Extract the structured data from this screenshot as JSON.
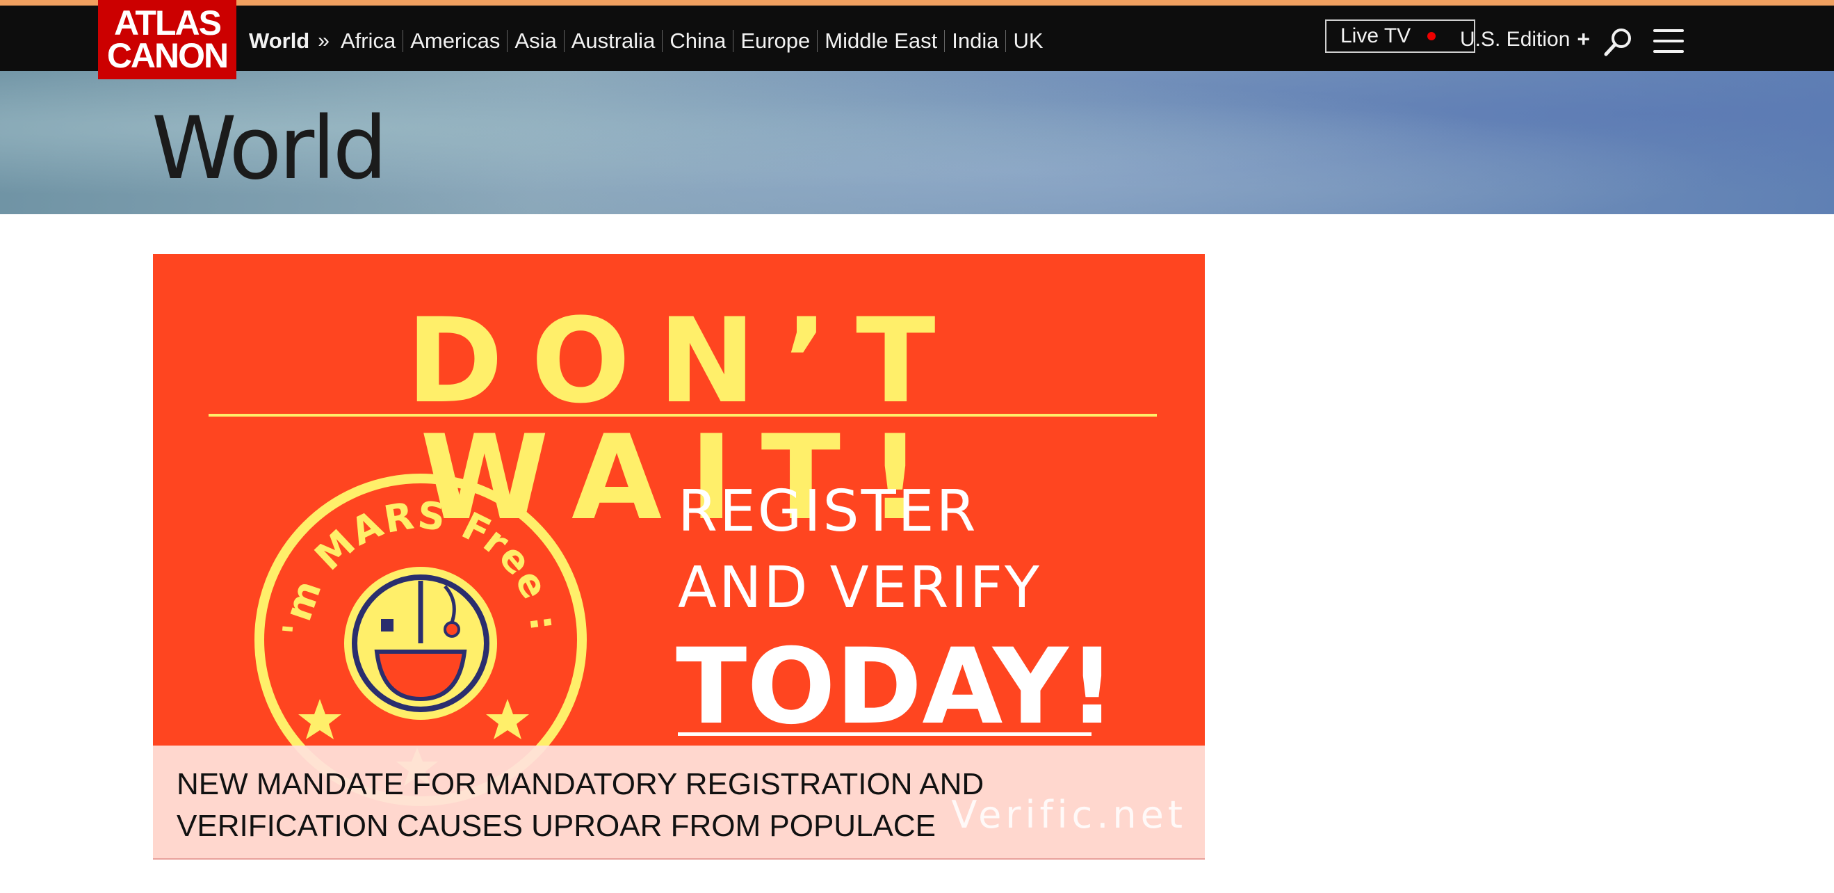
{
  "logo": {
    "line1": "ATLAS",
    "line2": "CANON"
  },
  "nav": {
    "home": "World",
    "chevron": "»",
    "sections": [
      "Africa",
      "Americas",
      "Asia",
      "Australia",
      "China",
      "Europe",
      "Middle East",
      "India",
      "UK"
    ]
  },
  "live_tv": "Live TV",
  "edition": {
    "label": "U.S. Edition",
    "plus": "+"
  },
  "icons": {
    "search": "search-icon",
    "menu": "hamburger-menu-icon",
    "live": "live-dot-icon"
  },
  "hero": {
    "title": "World"
  },
  "ad": {
    "headline": "DON’T WAIT!",
    "seal_text": "I'm MARS Free :)",
    "line1": "REGISTER",
    "line2": "AND VERIFY",
    "line3": "TODAY!",
    "watermark": "Verific.net"
  },
  "article": {
    "caption_line1": "NEW MANDATE FOR MANDATORY REGISTRATION AND",
    "caption_line2": "VERIFICATION CAUSES UPROAR FROM POPULACE"
  },
  "colors": {
    "brand_red": "#cc0000",
    "ad_orange": "#ff4520",
    "ad_yellow": "#ffef6a",
    "nav_bg": "#0d0d0d",
    "live_red": "#ee0000"
  }
}
